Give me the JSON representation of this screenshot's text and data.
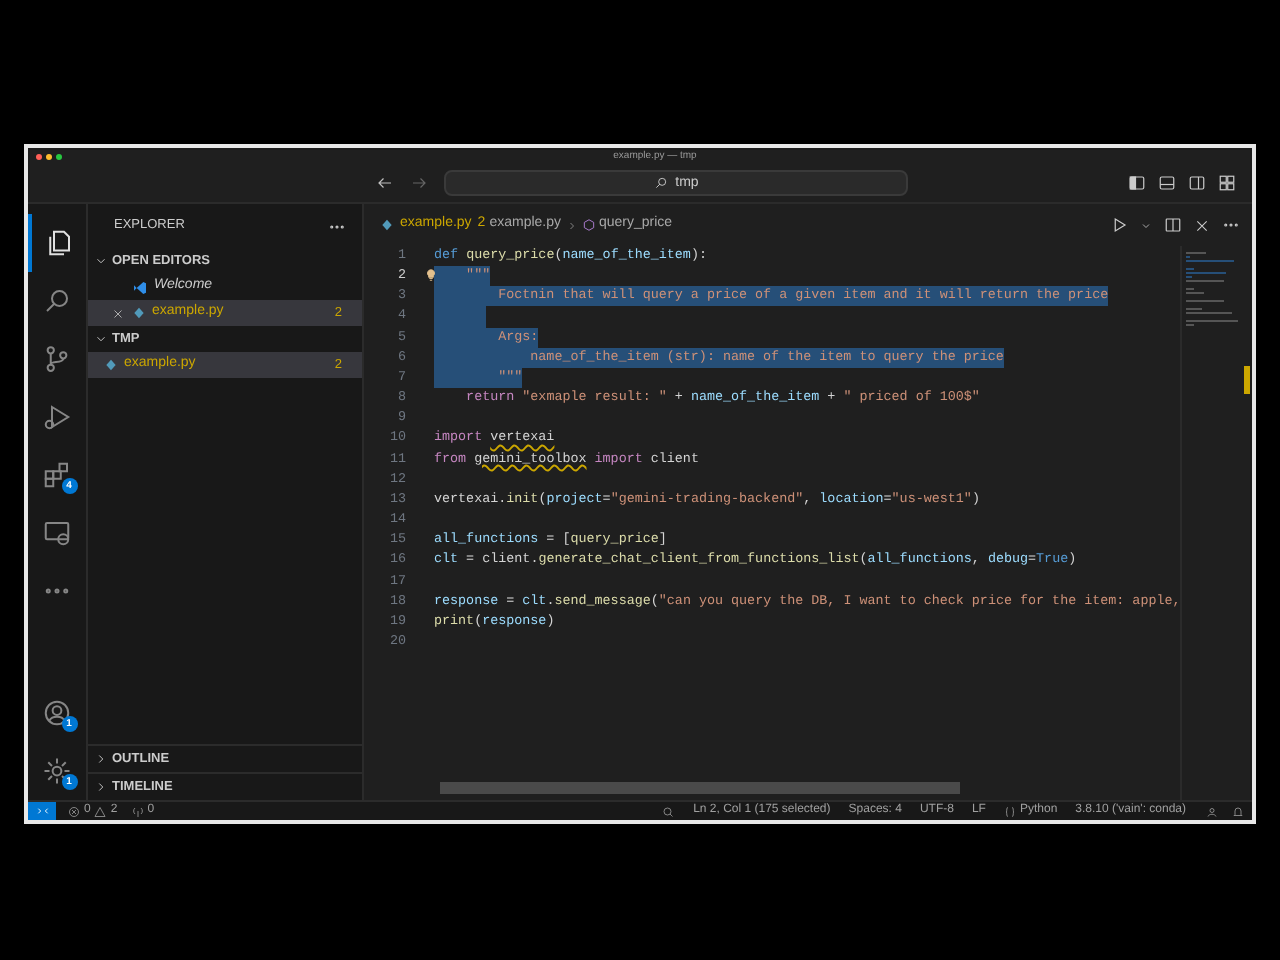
{
  "window": {
    "title": "example.py — tmp"
  },
  "command_center": {
    "search": "tmp"
  },
  "activity_bar": [
    {
      "kind": "files",
      "selected": true
    },
    {
      "kind": "search",
      "selected": false
    },
    {
      "kind": "source-control",
      "selected": false
    },
    {
      "kind": "run",
      "selected": false
    },
    {
      "kind": "extensions",
      "selected": false,
      "badge": "4"
    },
    {
      "kind": "remote",
      "selected": false
    },
    {
      "kind": "more",
      "selected": false
    }
  ],
  "activity_bottom": [
    {
      "kind": "account",
      "badge": "1"
    },
    {
      "kind": "settings",
      "badge": "1"
    }
  ],
  "sidebar": {
    "title": "EXPLORER",
    "sections": [
      {
        "label": "OPEN EDITORS",
        "expanded": true,
        "items": [
          {
            "kind": "welcome",
            "name": "Welcome",
            "selected": false,
            "closable": false
          },
          {
            "kind": "python",
            "name": "example.py",
            "problems": "2",
            "selected": true,
            "closable": true
          }
        ]
      },
      {
        "label": "TMP",
        "expanded": true,
        "items": [
          {
            "kind": "python",
            "name": "example.py",
            "problems": "2",
            "selected": true,
            "closable": false
          }
        ]
      }
    ],
    "bottom_sections": [
      {
        "label": "OUTLINE",
        "expanded": false
      },
      {
        "label": "TIMELINE",
        "expanded": false
      }
    ]
  },
  "editor": {
    "tab": {
      "name": "example.py",
      "problems": "2"
    },
    "breadcrumb": [
      {
        "kind": "file",
        "text": "example.py"
      },
      {
        "kind": "symbol",
        "text": "query_price"
      }
    ],
    "lines": [
      {
        "number": "1",
        "selected": false,
        "tokens": [
          {
            "kind": "kw",
            "text": "def "
          },
          {
            "kind": "fn",
            "text": "query_price"
          },
          {
            "kind": "plain",
            "text": "("
          },
          {
            "kind": "param",
            "text": "name_of_the_item"
          },
          {
            "kind": "plain",
            "text": "):"
          }
        ]
      },
      {
        "number": "2",
        "selected": true,
        "current": true,
        "lightbulb": true,
        "tokens": [
          {
            "kind": "str",
            "text": "    \"\"\""
          }
        ]
      },
      {
        "number": "3",
        "selected": true,
        "tokens": [
          {
            "kind": "str",
            "text": "        Foctnin that will query a price of a given item and it will return the price"
          }
        ]
      },
      {
        "number": "4",
        "selected": true
      },
      {
        "number": "5",
        "selected": true,
        "tokens": [
          {
            "kind": "str",
            "text": "        Args:"
          }
        ]
      },
      {
        "number": "6",
        "selected": true,
        "tokens": [
          {
            "kind": "str",
            "text": "            name_of_the_item (str): name of the item to query the price"
          }
        ]
      },
      {
        "number": "7",
        "selected": true,
        "tokens": [
          {
            "kind": "str",
            "text": "        \"\"\""
          }
        ]
      },
      {
        "number": "8",
        "selected": false,
        "tokens": [
          {
            "kind": "ctl",
            "text": "    return "
          },
          {
            "kind": "str",
            "text": "\"exmaple result: \""
          },
          {
            "kind": "plain",
            "text": " + "
          },
          {
            "kind": "param",
            "text": "name_of_the_item"
          },
          {
            "kind": "plain",
            "text": " + "
          },
          {
            "kind": "str",
            "text": "\" priced of 100$\""
          }
        ]
      },
      {
        "number": "9",
        "selected": false
      },
      {
        "number": "10",
        "selected": false,
        "tokens": [
          {
            "kind": "ctl",
            "text": "import "
          },
          {
            "kind": "mod",
            "text": "vertexai",
            "squiggle": true
          }
        ]
      },
      {
        "number": "11",
        "selected": false,
        "tokens": [
          {
            "kind": "ctl",
            "text": "from "
          },
          {
            "kind": "mod",
            "text": "gemini_toolbox",
            "squiggle": true
          },
          {
            "kind": "ctl",
            "text": " import "
          },
          {
            "kind": "mod",
            "text": "client"
          }
        ]
      },
      {
        "number": "12",
        "selected": false
      },
      {
        "number": "13",
        "selected": false,
        "tokens": [
          {
            "kind": "mod",
            "text": "vertexai"
          },
          {
            "kind": "plain",
            "text": "."
          },
          {
            "kind": "fn",
            "text": "init"
          },
          {
            "kind": "plain",
            "text": "("
          },
          {
            "kind": "param",
            "text": "project"
          },
          {
            "kind": "plain",
            "text": "="
          },
          {
            "kind": "str",
            "text": "\"gemini-trading-backend\""
          },
          {
            "kind": "plain",
            "text": ", "
          },
          {
            "kind": "param",
            "text": "location"
          },
          {
            "kind": "plain",
            "text": "="
          },
          {
            "kind": "str",
            "text": "\"us-west1\""
          },
          {
            "kind": "plain",
            "text": ")"
          }
        ]
      },
      {
        "number": "14",
        "selected": false
      },
      {
        "number": "15",
        "selected": false,
        "tokens": [
          {
            "kind": "param",
            "text": "all_functions"
          },
          {
            "kind": "plain",
            "text": " = ["
          },
          {
            "kind": "fn",
            "text": "query_price"
          },
          {
            "kind": "plain",
            "text": "]"
          }
        ]
      },
      {
        "number": "16",
        "selected": false,
        "tokens": [
          {
            "kind": "param",
            "text": "clt"
          },
          {
            "kind": "plain",
            "text": " = "
          },
          {
            "kind": "mod",
            "text": "client"
          },
          {
            "kind": "plain",
            "text": "."
          },
          {
            "kind": "fn",
            "text": "generate_chat_client_from_functions_list"
          },
          {
            "kind": "plain",
            "text": "("
          },
          {
            "kind": "param",
            "text": "all_functions"
          },
          {
            "kind": "plain",
            "text": ", "
          },
          {
            "kind": "param",
            "text": "debug"
          },
          {
            "kind": "plain",
            "text": "="
          },
          {
            "kind": "kw",
            "text": "True"
          },
          {
            "kind": "plain",
            "text": ")"
          }
        ]
      },
      {
        "number": "17",
        "selected": false
      },
      {
        "number": "18",
        "selected": false,
        "tokens": [
          {
            "kind": "param",
            "text": "response"
          },
          {
            "kind": "plain",
            "text": " = "
          },
          {
            "kind": "param",
            "text": "clt"
          },
          {
            "kind": "plain",
            "text": "."
          },
          {
            "kind": "fn",
            "text": "send_message"
          },
          {
            "kind": "plain",
            "text": "("
          },
          {
            "kind": "str",
            "text": "\"can you query the DB, I want to check price for the item: apple,"
          }
        ]
      },
      {
        "number": "19",
        "selected": false,
        "tokens": [
          {
            "kind": "fn",
            "text": "print"
          },
          {
            "kind": "plain",
            "text": "("
          },
          {
            "kind": "param",
            "text": "response"
          },
          {
            "kind": "plain",
            "text": ")"
          }
        ]
      },
      {
        "number": "20",
        "selected": false
      }
    ]
  },
  "status_bar": {
    "errors": "0",
    "warnings": "2",
    "ports": "0",
    "position": "Ln 2, Col 1 (175 selected)",
    "indent": "Spaces: 4",
    "encoding": "UTF-8",
    "eol": "LF",
    "language": "Python",
    "interpreter": "3.8.10 ('vain': conda)"
  }
}
